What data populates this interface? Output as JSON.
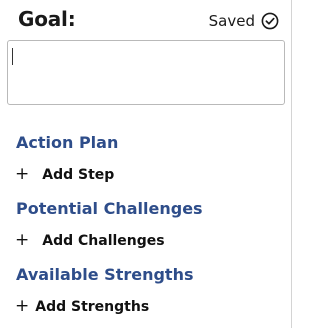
{
  "goal": {
    "title": "Goal:",
    "status_label": "Saved",
    "status_icon": "check-circle-icon",
    "input_value": "",
    "input_placeholder": ""
  },
  "sections": [
    {
      "title": "Action Plan",
      "add_label": "Add Step"
    },
    {
      "title": "Potential Challenges",
      "add_label": "Add Challenges"
    },
    {
      "title": "Available Strengths",
      "add_label": "Add Strengths"
    }
  ],
  "colors": {
    "section_title": "#2e4d8a",
    "text": "#1a1a1a",
    "input_border": "#b9b9b9"
  }
}
